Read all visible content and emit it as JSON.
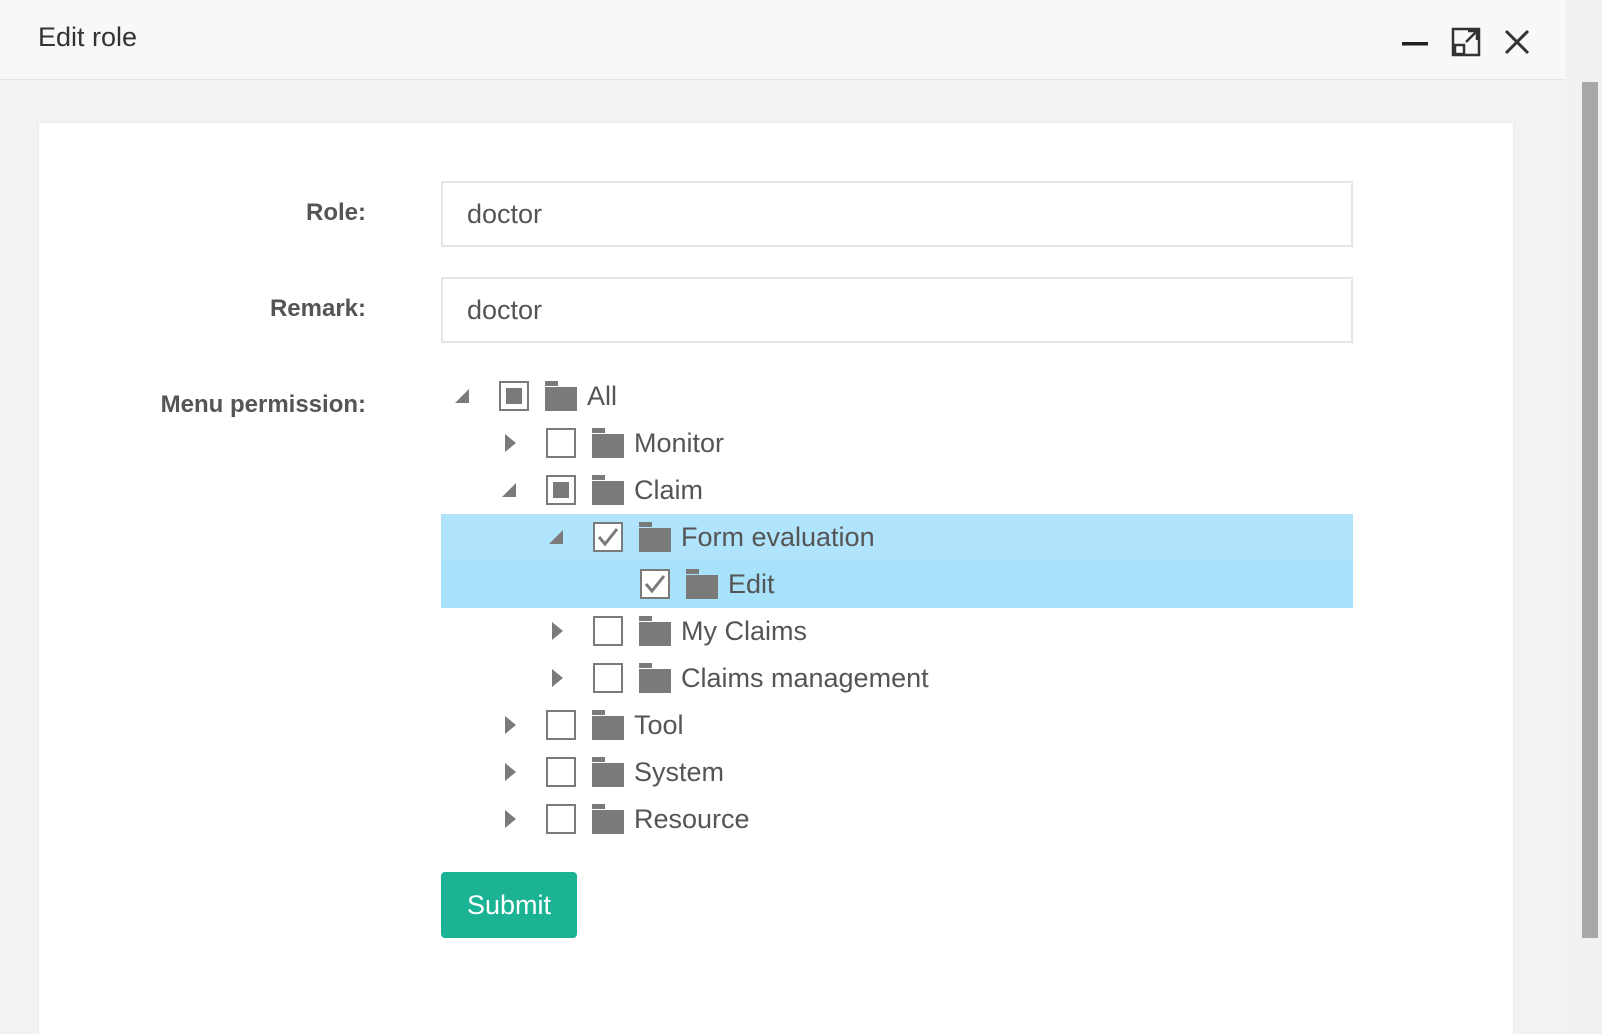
{
  "dialog": {
    "title": "Edit role",
    "controls": [
      "minimize-icon",
      "maximize-icon",
      "close-icon"
    ]
  },
  "form": {
    "role_label": "Role:",
    "role_value": "doctor",
    "remark_label": "Remark:",
    "remark_value": "doctor",
    "menu_label": "Menu permission:",
    "submit_label": "Submit"
  },
  "tree": [
    {
      "label": "All",
      "expanded": true,
      "state": "partial"
    },
    {
      "label": "Monitor",
      "expanded": false,
      "state": "unchecked"
    },
    {
      "label": "Claim",
      "expanded": true,
      "state": "partial"
    },
    {
      "label": "Form evaluation",
      "expanded": true,
      "state": "checked",
      "selected": true
    },
    {
      "label": "Edit",
      "state": "checked",
      "selected": true
    },
    {
      "label": "My Claims",
      "expanded": false,
      "state": "unchecked"
    },
    {
      "label": "Claims management",
      "expanded": false,
      "state": "unchecked"
    },
    {
      "label": "Tool",
      "expanded": false,
      "state": "unchecked"
    },
    {
      "label": "System",
      "expanded": false,
      "state": "unchecked"
    },
    {
      "label": "Resource",
      "expanded": false,
      "state": "unchecked"
    }
  ],
  "colors": {
    "selected_row": "#b0e3fc",
    "submit_button": "#1bb394",
    "icon_gray": "#7a7a7a"
  }
}
